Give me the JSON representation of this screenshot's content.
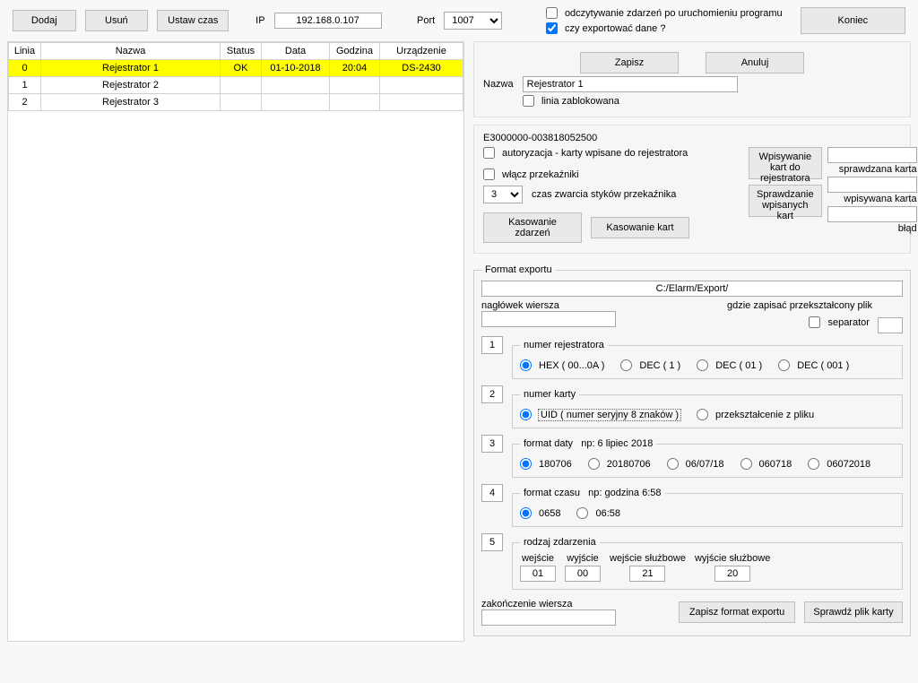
{
  "toolbar": {
    "add": "Dodaj",
    "del": "Usuń",
    "set_time": "Ustaw czas",
    "ip_label": "IP",
    "ip_value": "192.168.0.107",
    "port_label": "Port",
    "port_value": "1007",
    "chk_read_events": "odczytywanie zdarzeń po uruchomieniu programu",
    "chk_export": "czy exportować dane ?",
    "finish": "Koniec"
  },
  "table": {
    "headers": {
      "line": "Linia",
      "name": "Nazwa",
      "status": "Status",
      "date": "Data",
      "time": "Godzina",
      "device": "Urządzenie"
    },
    "rows": [
      {
        "line": "0",
        "name": "Rejestrator 1",
        "status": "OK",
        "date": "01-10-2018",
        "time": "20:04",
        "device": "DS-2430",
        "sel": true
      },
      {
        "line": "1",
        "name": "Rejestrator 2",
        "status": "",
        "date": "",
        "time": "",
        "device": "",
        "sel": false
      },
      {
        "line": "2",
        "name": "Rejestrator 3",
        "status": "",
        "date": "",
        "time": "",
        "device": "",
        "sel": false
      }
    ]
  },
  "editor": {
    "save": "Zapisz",
    "cancel": "Anuluj",
    "name_label": "Nazwa",
    "name_value": "Rejestrator 1",
    "blocked": "linia zablokowana"
  },
  "device": {
    "id": "E3000000-003818052500",
    "auth": "autoryzacja - karty wpisane do rejestratora",
    "relay_on": "włącz przekaźniki",
    "relay_time_value": "3",
    "relay_time_label": "czas zwarcia styków przekaźnika",
    "btn_write_cards": "Wpisywanie kart do rejestratora",
    "btn_check_cards": "Sprawdzanie wpisanych kart",
    "checked_card_label": "sprawdzana karta",
    "written_card_label": "wpisywana karta",
    "error_label": "błąd",
    "btn_clear_events": "Kasowanie zdarzeń",
    "btn_clear_cards": "Kasowanie kart"
  },
  "export": {
    "legend": "Format exportu",
    "path": "C:/Elarm/Export/",
    "row_header_label": "nagłówek wiersza",
    "where_save": "gdzie zapisać przekształcony plik",
    "separator_label": "separator",
    "sec1": {
      "num": "1",
      "legend": "numer rejestratora",
      "opts": [
        "HEX ( 00...0A )",
        "DEC ( 1 )",
        "DEC ( 01 )",
        "DEC ( 001 )"
      ],
      "selected": 0
    },
    "sec2": {
      "num": "2",
      "legend": "numer karty",
      "opts": [
        "UID ( numer seryjny 8 znaków )",
        "przekształcenie z pliku"
      ],
      "selected": 0
    },
    "sec3": {
      "num": "3",
      "legend": "format daty",
      "example": "np:  6 lipiec 2018",
      "opts": [
        "180706",
        "20180706",
        "06/07/18",
        "060718",
        "06072018"
      ],
      "selected": 0
    },
    "sec4": {
      "num": "4",
      "legend": "format czasu",
      "example": "np:  godzina 6:58",
      "opts": [
        "0658",
        "06:58"
      ],
      "selected": 0
    },
    "sec5": {
      "num": "5",
      "legend": "rodzaj zdarzenia",
      "cols": [
        "wejście",
        "wyjście",
        "wejście służbowe",
        "wyjście służbowe"
      ],
      "vals": [
        "01",
        "00",
        "21",
        "20"
      ]
    },
    "row_end_label": "zakończenie wiersza",
    "row_end_value": "",
    "btn_save_format": "Zapisz format exportu",
    "btn_check_file": "Sprawdź plik karty"
  }
}
